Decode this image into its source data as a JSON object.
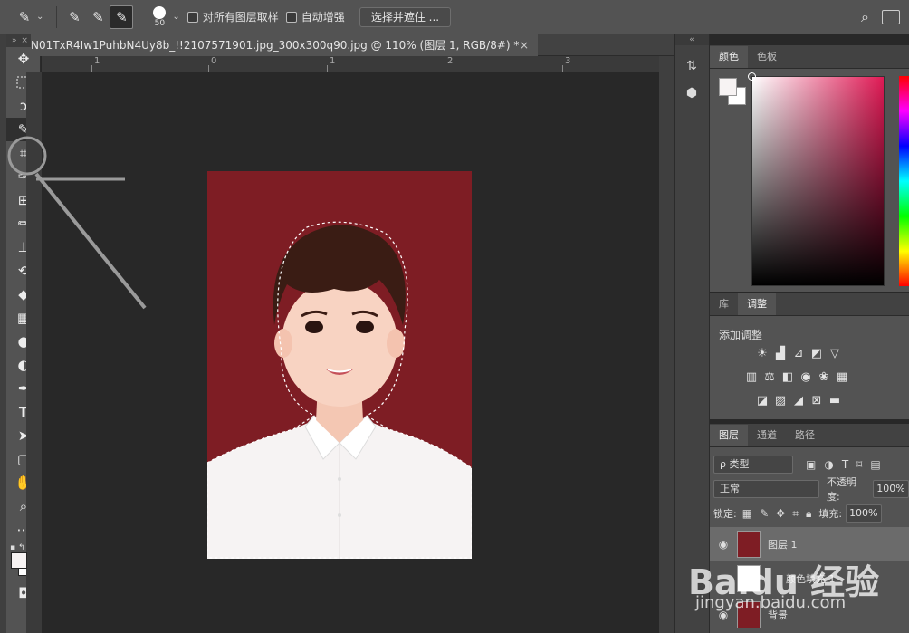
{
  "options_bar": {
    "brush_size": "50",
    "sample_all_layers_label": "对所有图层取样",
    "auto_enhance_label": "自动增强",
    "select_and_mask_label": "选择并遮住 ..."
  },
  "document": {
    "tab_title": "N01TxR4Iw1PuhbN4Uy8b_!!2107571901.jpg_300x300q90.jpg @ 110% (图层 1, RGB/8#) *",
    "close_glyph": "×"
  },
  "ruler": {
    "ticks": [
      "1",
      "0",
      "1",
      "2",
      "3"
    ]
  },
  "color_panel": {
    "tabs": [
      "颜色",
      "色板"
    ],
    "fg_color": "#f7f3f3",
    "bg_color": "#ffffff"
  },
  "adjust_panel": {
    "tabs": [
      "库",
      "调整"
    ],
    "title": "添加调整"
  },
  "layers_panel": {
    "tabs": [
      "图层",
      "通道",
      "路径"
    ],
    "filter_label": "ρ 类型",
    "blend_mode": "正常",
    "opacity_label": "不透明度:",
    "opacity_value": "100%",
    "lock_label": "锁定:",
    "fill_label": "填充:",
    "fill_value": "100%",
    "layers": [
      {
        "name": "图层 1",
        "selected": true
      },
      {
        "name": "颜色填充 1",
        "selected": false
      },
      {
        "name": "背景",
        "selected": false
      }
    ]
  },
  "watermark": {
    "main": "Baidu 经验",
    "sub": "jingyan.baidu.com"
  },
  "colors": {
    "photo_bg": "#7e1d24",
    "panel": "#535353",
    "workspace": "#282828"
  }
}
